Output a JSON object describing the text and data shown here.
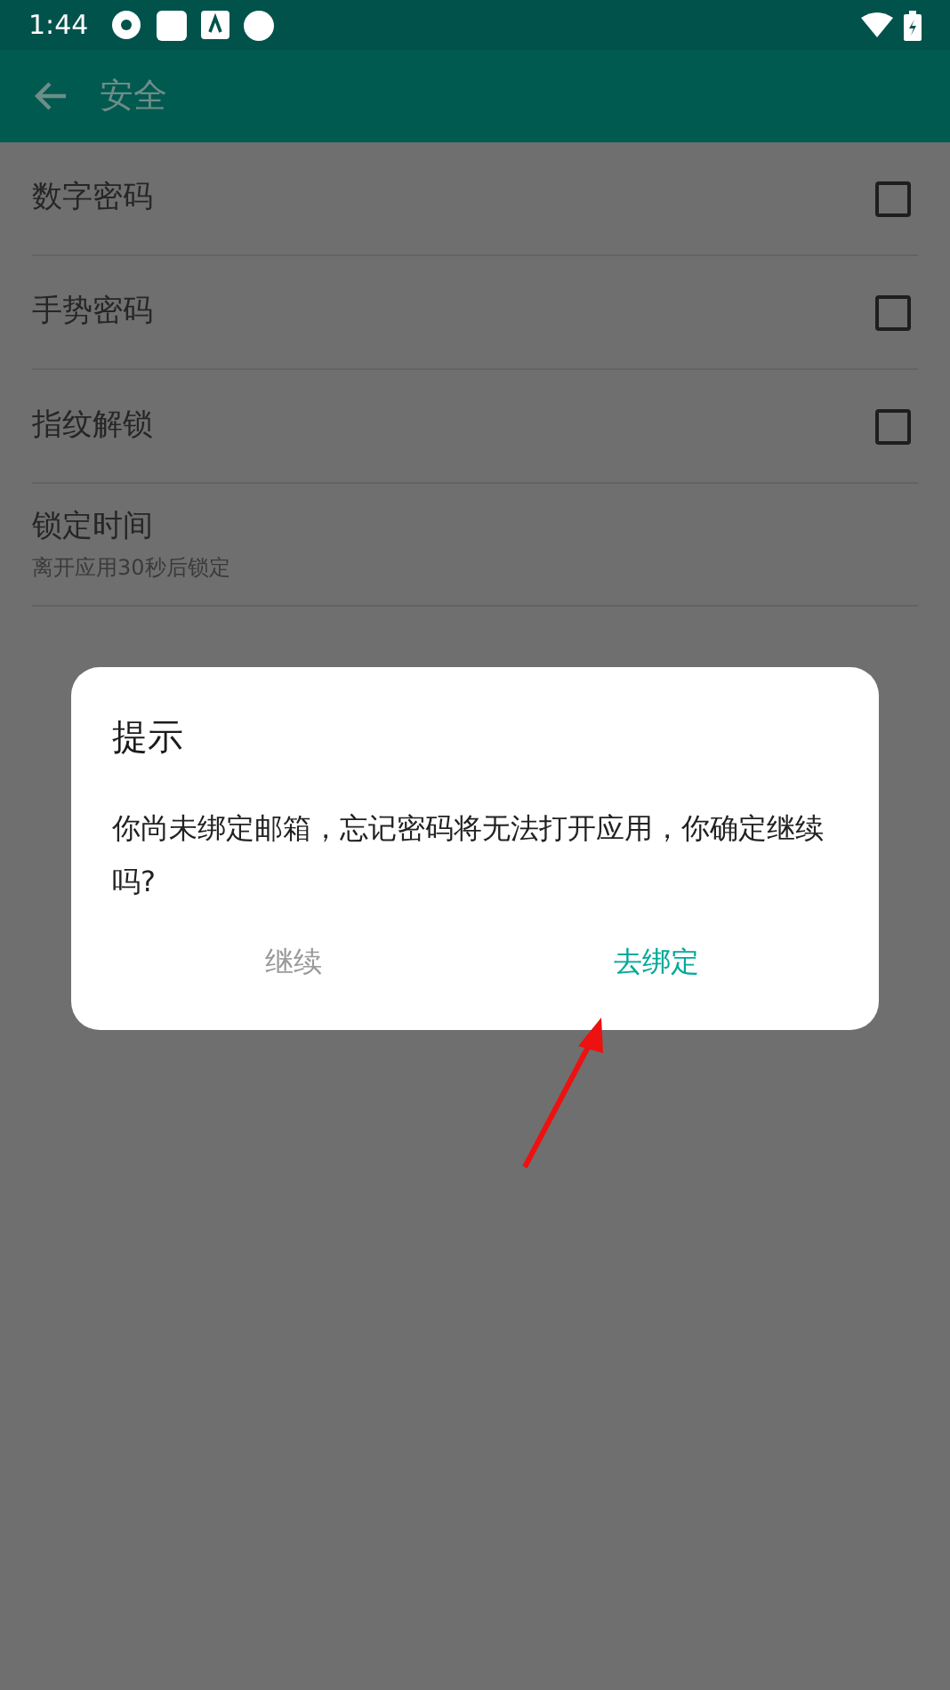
{
  "status_bar": {
    "time": "1:44"
  },
  "toolbar": {
    "title": "安全"
  },
  "settings": [
    {
      "kind": "checkbox",
      "title": "数字密码",
      "checked": false
    },
    {
      "kind": "checkbox",
      "title": "手势密码",
      "checked": false
    },
    {
      "kind": "checkbox",
      "title": "指纹解锁",
      "checked": false
    },
    {
      "kind": "detail",
      "title": "锁定时间",
      "subtitle": "离开应用30秒后锁定"
    }
  ],
  "dialog": {
    "title": "提示",
    "message": "你尚未绑定邮箱，忘记密码将无法打开应用，你确定继续吗?",
    "buttons": [
      {
        "kind": "neutral",
        "label": "继续"
      },
      {
        "kind": "primary",
        "label": "去绑定"
      }
    ]
  }
}
